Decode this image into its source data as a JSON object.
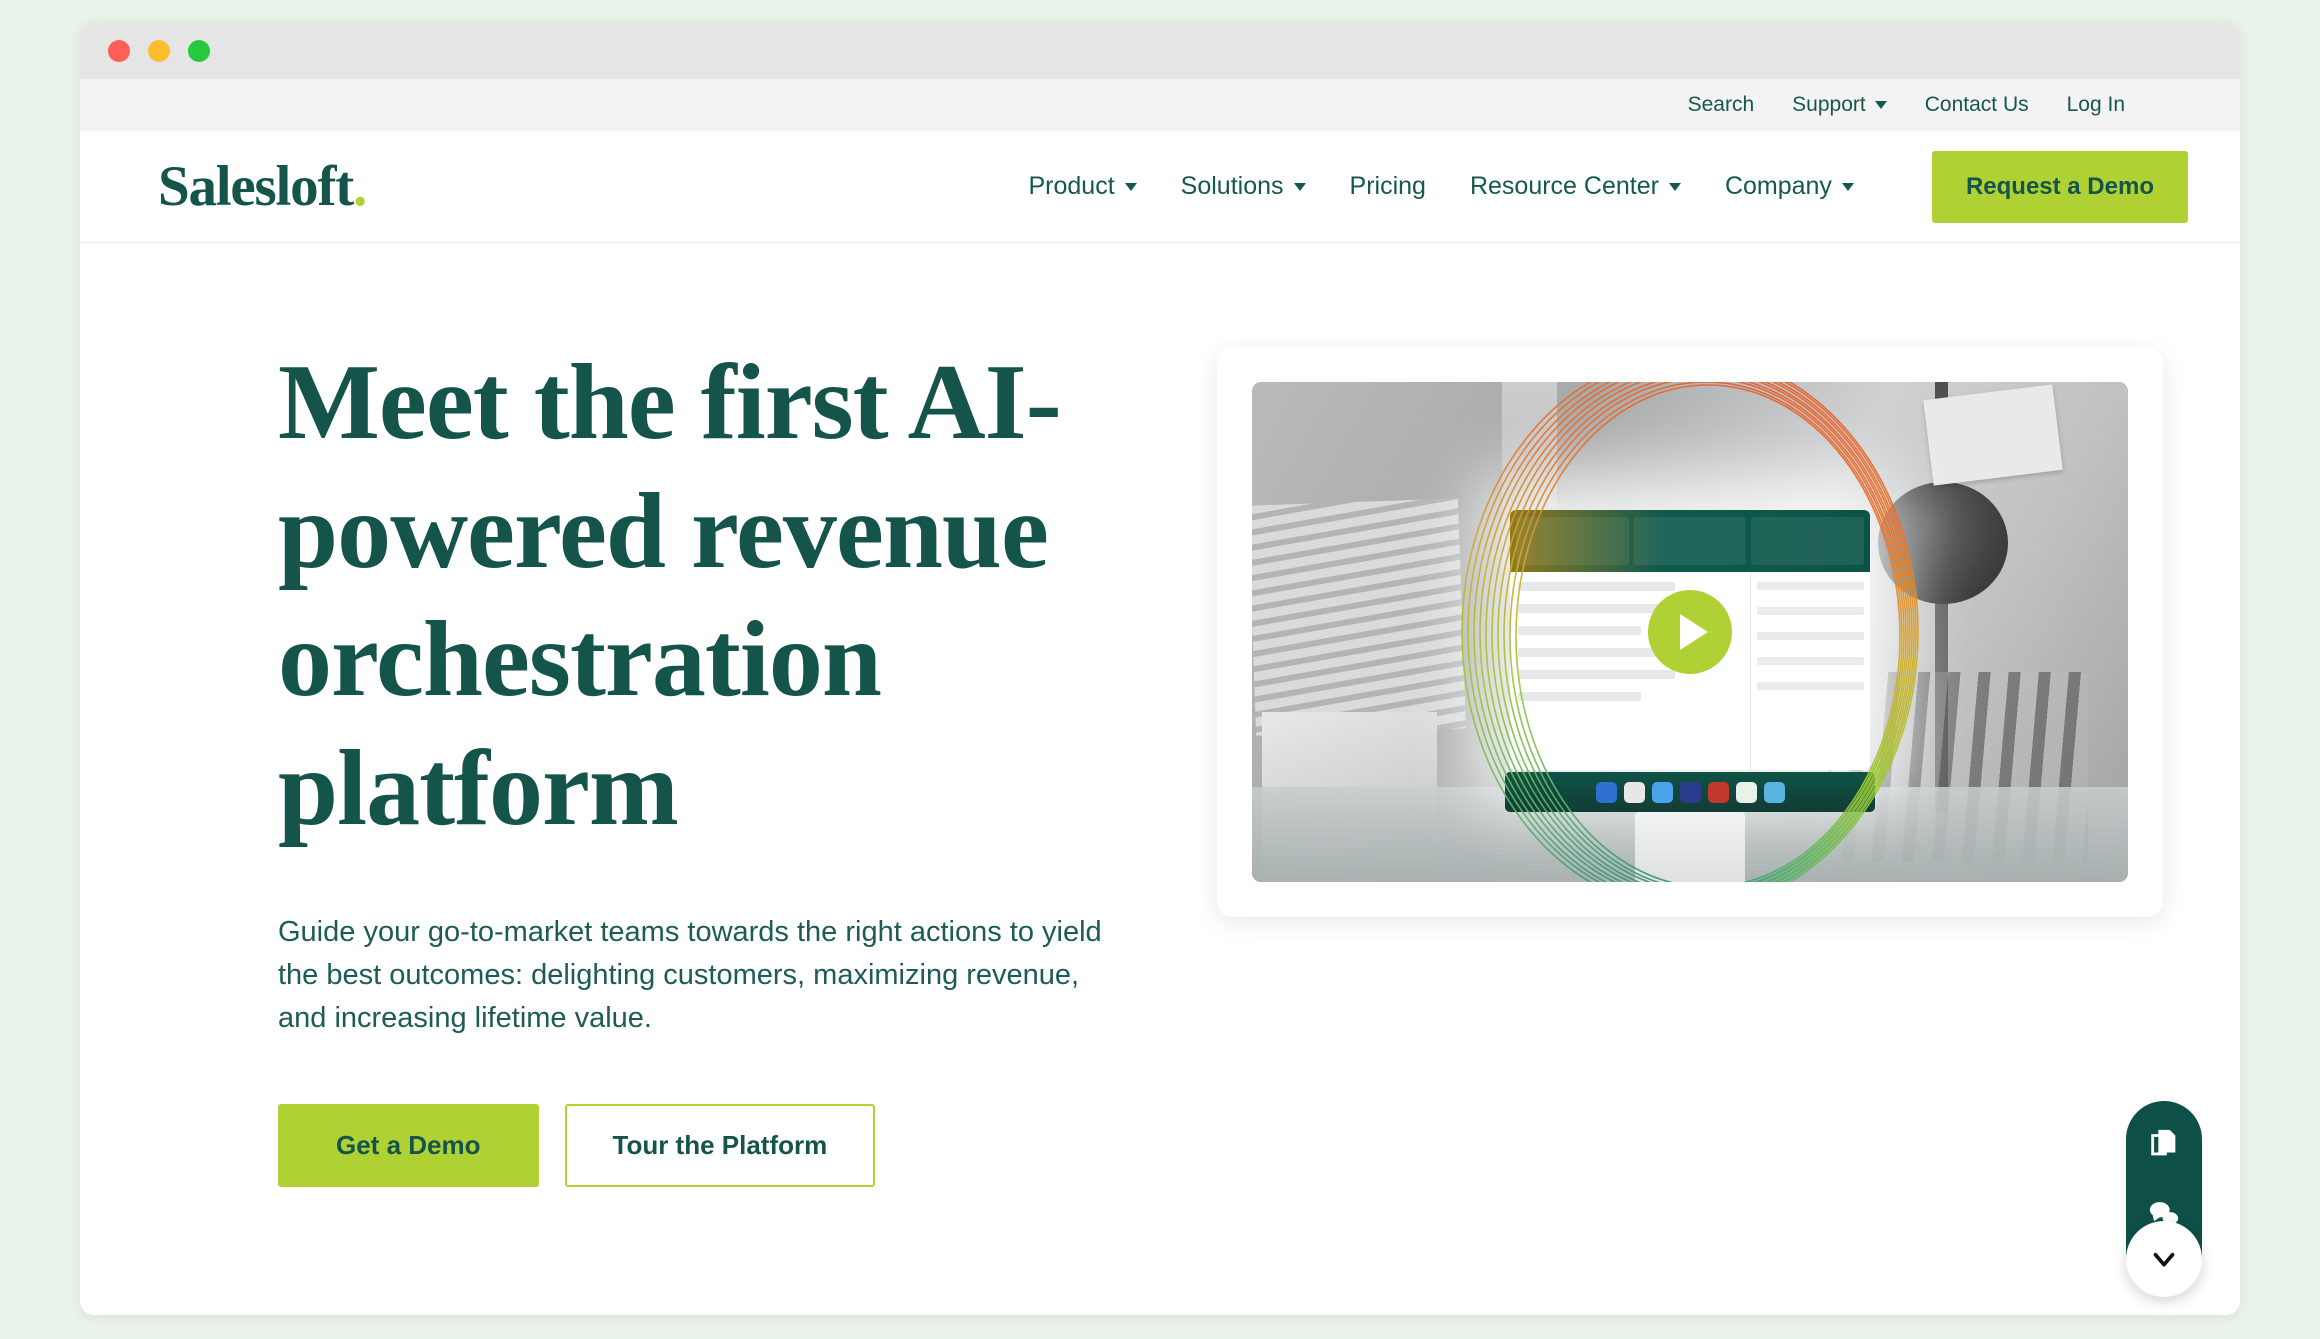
{
  "browser": {
    "traffic_lights": [
      {
        "name": "close",
        "color": "#ff5f56"
      },
      {
        "name": "minimize",
        "color": "#ffbd2e"
      },
      {
        "name": "maximize",
        "color": "#27c93f"
      }
    ]
  },
  "utility_nav": {
    "items": [
      {
        "label": "Search",
        "has_dropdown": false
      },
      {
        "label": "Support",
        "has_dropdown": true
      },
      {
        "label": "Contact Us",
        "has_dropdown": false
      },
      {
        "label": "Log In",
        "has_dropdown": false
      }
    ]
  },
  "header": {
    "logo_text": "Salesloft",
    "logo_dot": ".",
    "nav_items": [
      {
        "label": "Product",
        "has_dropdown": true
      },
      {
        "label": "Solutions",
        "has_dropdown": true
      },
      {
        "label": "Pricing",
        "has_dropdown": false
      },
      {
        "label": "Resource Center",
        "has_dropdown": true
      },
      {
        "label": "Company",
        "has_dropdown": true
      }
    ],
    "cta_label": "Request a Demo"
  },
  "hero": {
    "title": "Meet the first AI-powered revenue orchestration platform",
    "subtitle": "Guide your go-to-market teams towards the right actions to yield the best outcomes: delighting customers, maximizing revenue, and increasing lifetime value.",
    "primary_cta": "Get a Demo",
    "secondary_cta": "Tour the Platform"
  },
  "video": {
    "play_label": "Play video"
  },
  "float_widget": {
    "icons": [
      "documents-icon",
      "chat-bubbles-icon"
    ],
    "toggle_icon": "chevron-down-icon"
  },
  "colors": {
    "brand_green": "#14544a",
    "dark_green": "#0e5048",
    "lime": "#afd134",
    "page_bg": "#e9f3e9"
  }
}
